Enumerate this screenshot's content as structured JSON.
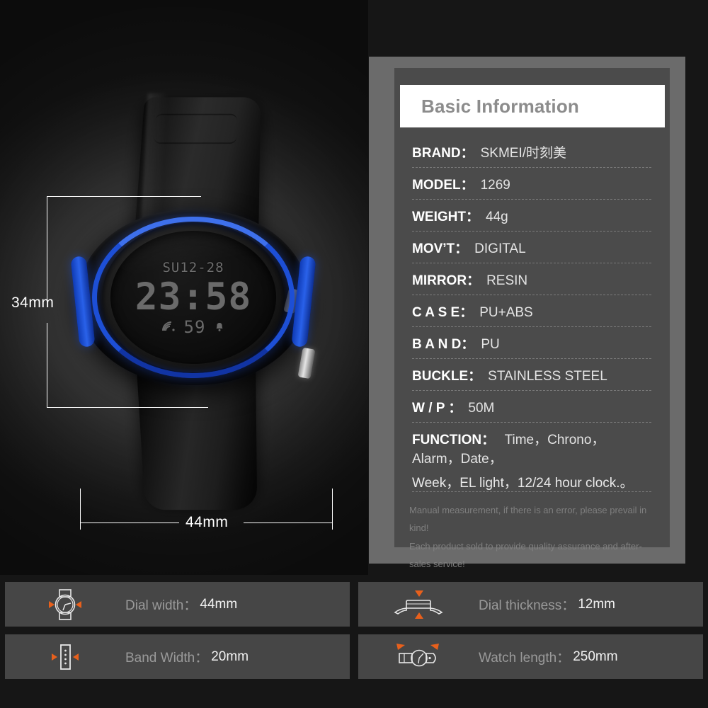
{
  "product_photo": {
    "watch_display": {
      "day_date": "SU12-28",
      "time": "23:58",
      "seconds": "59",
      "signal_icon": "signal-wave-icon",
      "alarm_icon": "bell-icon"
    },
    "dimensions": {
      "height_label": "34mm",
      "width_label": "44mm"
    }
  },
  "spec_panel": {
    "title": "Basic Information",
    "rows": [
      {
        "key": "BRAND：",
        "value": "SKMEI/时刻美"
      },
      {
        "key": "MODEL：",
        "value": "1269"
      },
      {
        "key": "WEIGHT：",
        "value": "44g"
      },
      {
        "key": "MOV’T：",
        "value": "DIGITAL"
      },
      {
        "key": "MIRROR：",
        "value": "RESIN"
      },
      {
        "key": "C A S E：",
        "value": "PU+ABS"
      },
      {
        "key": "B A N D：",
        "value": "PU"
      },
      {
        "key": "BUCKLE：",
        "value": "STAINLESS STEEL"
      },
      {
        "key": "W / P ：",
        "value": "50M"
      }
    ],
    "function_row": {
      "key": "FUNCTION：",
      "line1": "Time，Chrono，Alarm，Date，",
      "line2": "Week，EL light，12/24 hour clock.。"
    },
    "footnotes": [
      "Manual measurement, if there is an error, please prevail in kind!",
      "Each product sold to provide quality assurance and after-sales service!"
    ]
  },
  "info_boxes": [
    {
      "icon": "watch-dial-width-icon",
      "label": "Dial width：",
      "value": "44mm"
    },
    {
      "icon": "watch-thickness-icon",
      "label": "Dial thickness：",
      "value": "12mm"
    },
    {
      "icon": "band-width-icon",
      "label": "Band Width：",
      "value": "20mm"
    },
    {
      "icon": "watch-length-icon",
      "label": "Watch length：",
      "value": "250mm"
    }
  ],
  "colors": {
    "accent_blue": "#1d4fd6",
    "accent_orange": "#e8601c",
    "panel_outer": "#6b6b6b",
    "panel_inner": "#4b4b4b",
    "box_bg": "#464646",
    "background": "#161616"
  }
}
